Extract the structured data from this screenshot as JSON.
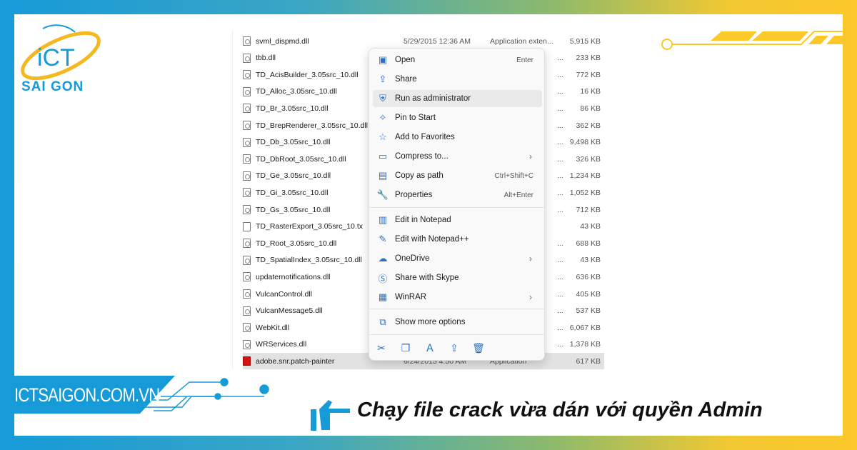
{
  "brand": {
    "logo_text_top": "iCT",
    "logo_text_bottom": "SAI GON",
    "website": "ICTSAIGON.COM.VN",
    "blue": "#169ad8",
    "yellow": "#fcc82a"
  },
  "files": [
    {
      "name": "svml_dispmd.dll",
      "date": "5/29/2015 12:36 AM",
      "type": "Application exten...",
      "size": "5,915 KB",
      "icon": "dll"
    },
    {
      "name": "tbb.dll",
      "date": "",
      "type": "...",
      "size": "233 KB",
      "icon": "dll"
    },
    {
      "name": "TD_AcisBuilder_3.05src_10.dll",
      "date": "",
      "type": "...",
      "size": "772 KB",
      "icon": "dll"
    },
    {
      "name": "TD_Alloc_3.05src_10.dll",
      "date": "",
      "type": "...",
      "size": "16 KB",
      "icon": "dll"
    },
    {
      "name": "TD_Br_3.05src_10.dll",
      "date": "",
      "type": "...",
      "size": "86 KB",
      "icon": "dll"
    },
    {
      "name": "TD_BrepRenderer_3.05src_10.dll",
      "date": "",
      "type": "...",
      "size": "362 KB",
      "icon": "dll"
    },
    {
      "name": "TD_Db_3.05src_10.dll",
      "date": "",
      "type": "...",
      "size": "9,498 KB",
      "icon": "dll"
    },
    {
      "name": "TD_DbRoot_3.05src_10.dll",
      "date": "",
      "type": "...",
      "size": "326 KB",
      "icon": "dll"
    },
    {
      "name": "TD_Ge_3.05src_10.dll",
      "date": "",
      "type": "...",
      "size": "1,234 KB",
      "icon": "dll"
    },
    {
      "name": "TD_Gi_3.05src_10.dll",
      "date": "",
      "type": "...",
      "size": "1,052 KB",
      "icon": "dll"
    },
    {
      "name": "TD_Gs_3.05src_10.dll",
      "date": "",
      "type": "...",
      "size": "712 KB",
      "icon": "dll"
    },
    {
      "name": "TD_RasterExport_3.05src_10.tx",
      "date": "",
      "type": "",
      "size": "43 KB",
      "icon": "file"
    },
    {
      "name": "TD_Root_3.05src_10.dll",
      "date": "",
      "type": "...",
      "size": "688 KB",
      "icon": "dll"
    },
    {
      "name": "TD_SpatialIndex_3.05src_10.dll",
      "date": "",
      "type": "...",
      "size": "43 KB",
      "icon": "dll"
    },
    {
      "name": "updaternotifications.dll",
      "date": "",
      "type": "...",
      "size": "636 KB",
      "icon": "dll"
    },
    {
      "name": "VulcanControl.dll",
      "date": "",
      "type": "...",
      "size": "405 KB",
      "icon": "dll"
    },
    {
      "name": "VulcanMessage5.dll",
      "date": "",
      "type": "...",
      "size": "537 KB",
      "icon": "dll"
    },
    {
      "name": "WebKit.dll",
      "date": "",
      "type": "...",
      "size": "6,067 KB",
      "icon": "dll"
    },
    {
      "name": "WRServices.dll",
      "date": "",
      "type": "...",
      "size": "1,378 KB",
      "icon": "dll"
    },
    {
      "name": "adobe.snr.patch-painter",
      "date": "6/24/2015 4:50 AM",
      "type": "Application",
      "size": "617 KB",
      "icon": "adobe",
      "selected": true
    }
  ],
  "context_menu": {
    "items": [
      {
        "label": "Open",
        "shortcut": "Enter",
        "icon": "open-icon"
      },
      {
        "label": "Share",
        "icon": "share-icon"
      },
      {
        "label": "Run as administrator",
        "icon": "shield-icon",
        "hover": true
      },
      {
        "label": "Pin to Start",
        "icon": "pin-icon"
      },
      {
        "label": "Add to Favorites",
        "icon": "star-icon"
      },
      {
        "label": "Compress to...",
        "icon": "zip-icon",
        "submenu": true
      },
      {
        "label": "Copy as path",
        "shortcut": "Ctrl+Shift+C",
        "icon": "path-icon"
      },
      {
        "label": "Properties",
        "shortcut": "Alt+Enter",
        "icon": "wrench-icon"
      },
      {
        "label": "Edit in Notepad",
        "icon": "notepad-icon"
      },
      {
        "label": "Edit with Notepad++",
        "icon": "notepadpp-icon"
      },
      {
        "label": "OneDrive",
        "icon": "cloud-icon",
        "submenu": true
      },
      {
        "label": "Share with Skype",
        "icon": "skype-icon"
      },
      {
        "label": "WinRAR",
        "icon": "winrar-icon",
        "submenu": true
      },
      {
        "label": "Show more options",
        "icon": "more-options-icon"
      }
    ],
    "bottom_icons": [
      "cut-icon",
      "copy-icon",
      "rename-icon",
      "share-icon",
      "delete-icon"
    ]
  },
  "caption": "Chạy file crack vừa dán với quyền Admin"
}
